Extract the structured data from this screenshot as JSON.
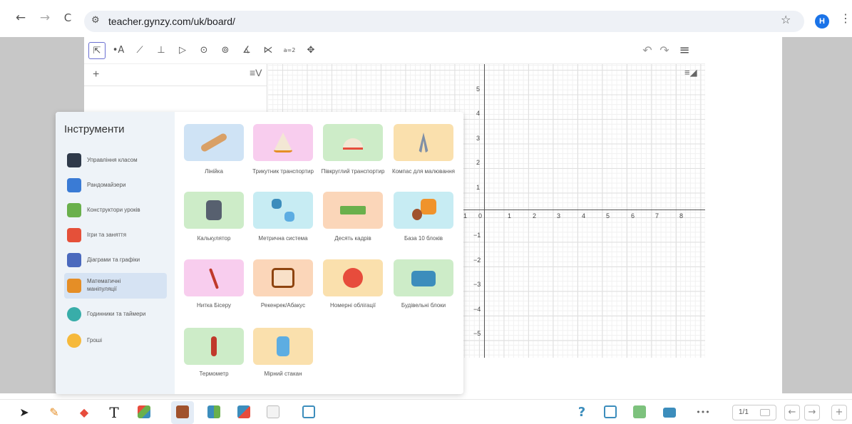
{
  "browser": {
    "back": "←",
    "forward": "→",
    "reload": "C",
    "url": "teacher.gynzy.com/uk/board/",
    "site_icon": "⚙",
    "bookmark": "☆",
    "profile_initial": "H",
    "menu": "⋮"
  },
  "geogebra": {
    "tools": [
      "⇱",
      "•A",
      "⟋",
      "⊥",
      "▷",
      "⊙",
      "⊚",
      "∡",
      "⋉",
      "a=2",
      "✥"
    ],
    "undo": "↶",
    "redo": "↷",
    "menu": "≡",
    "algebra_add": "+",
    "algebra_menu": "≡V",
    "graph_style": "≡◢",
    "x_ticks": [
      "1",
      "0",
      "1",
      "2",
      "3",
      "4",
      "5",
      "6",
      "7",
      "8"
    ],
    "y_ticks": [
      "5",
      "4",
      "3",
      "2",
      "1",
      "−1",
      "−2",
      "−3",
      "−4",
      "−5"
    ]
  },
  "tools_panel": {
    "title": "Інструменти",
    "categories": [
      {
        "label": "Управління класом",
        "color": "#2f3a4a"
      },
      {
        "label": "Рандомайзери",
        "color": "#3a7bd5"
      },
      {
        "label": "Конструктори уроків",
        "color": "#6ab04c"
      },
      {
        "label": "Ігри та заняття",
        "color": "#e55039"
      },
      {
        "label": "Діаграми та графіки",
        "color": "#4a69bd"
      },
      {
        "label": "Математичні маніпуляції",
        "color": "#e58e26"
      },
      {
        "label": "Годинники та таймери",
        "color": "#38ada9"
      },
      {
        "label": "Гроші",
        "color": "#f6b93b"
      }
    ],
    "tiles": [
      {
        "label": "Лінійка",
        "bg": "#cfe3f5",
        "icon": "#d9a066"
      },
      {
        "label": "Трикутник транспортир",
        "bg": "#f8cdee",
        "icon": "#f3e7d4"
      },
      {
        "label": "Півкруглий транспортир",
        "bg": "#cdecc8",
        "icon": "#f3e7d4"
      },
      {
        "label": "Компас для малювання",
        "bg": "#fae0ad",
        "icon": "#7f8fa6"
      },
      {
        "label": "Калькулятор",
        "bg": "#cdecc8",
        "icon": "#57606f"
      },
      {
        "label": "Метрична система",
        "bg": "#c7ecf3",
        "icon": "#3c8dbc"
      },
      {
        "label": "Десять кадрів",
        "bg": "#fbd6b9",
        "icon": "#6ab04c"
      },
      {
        "label": "База 10 блоків",
        "bg": "#c7ecf3",
        "icon": "#f0932b"
      },
      {
        "label": "Нитка Бісеру",
        "bg": "#f8cdee",
        "icon": "#c0392b"
      },
      {
        "label": "Рекенрек/Абакус",
        "bg": "#fbd6b9",
        "icon": "#d35400"
      },
      {
        "label": "Номерні облігації",
        "bg": "#fae0ad",
        "icon": "#e74c3c"
      },
      {
        "label": "Будівельні блоки",
        "bg": "#cdecc8",
        "icon": "#3c8dbc"
      },
      {
        "label": "Термометр",
        "bg": "#cdecc8",
        "icon": "#c0392b"
      },
      {
        "label": "Мірний стакан",
        "bg": "#fae0ad",
        "icon": "#5dade2"
      }
    ]
  },
  "bottom_toolbar": {
    "help": "?",
    "more": "•••",
    "page": "1/1",
    "prev": "←",
    "next": "→",
    "add": "+"
  }
}
